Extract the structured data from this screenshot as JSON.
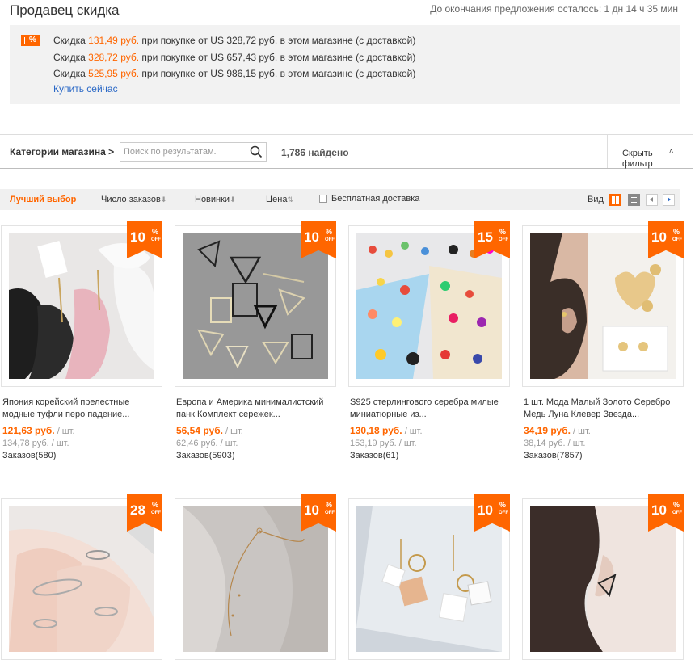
{
  "promo": {
    "title": "Продавец скидка",
    "timer": "До окончания предложения осталось: 1 дн 14 ч 35 мин",
    "badge": "%",
    "lines": [
      {
        "pre": "Скидка ",
        "amount": "131,49 руб.",
        "post": " при покупке от US 328,72 руб. в этом магазине (с доставкой)"
      },
      {
        "pre": "Скидка ",
        "amount": "328,72 руб.",
        "post": " при покупке от US 657,43 руб. в этом магазине (с доставкой)"
      },
      {
        "pre": "Скидка ",
        "amount": "525,95 руб.",
        "post": " при покупке от US 986,15 руб. в этом магазине (с доставкой)"
      }
    ],
    "buy_now": "Купить сейчас"
  },
  "catbar": {
    "label": "Категории магазина >",
    "search_placeholder": "Поиск по результатам.",
    "found": "1,786 найдено",
    "hide_filter": "Скрыть фильтр",
    "hide_arrow": "˄"
  },
  "sortbar": {
    "best": "Лучший выбор",
    "orders": "Число заказов",
    "new": "Новинки",
    "price": "Цена",
    "free_shipping": "Бесплатная доставка",
    "view": "Вид",
    "arrow_down": "⬇",
    "arrow_updown": "⇅"
  },
  "products": [
    {
      "discount": "10",
      "title": "Япония корейский прелестные модные туфли перо падение...",
      "price": "121,63 руб.",
      "unit": " / шт.",
      "old_price": "134,78 руб. / шт.",
      "orders": "Заказов(580)"
    },
    {
      "discount": "10",
      "title": "Европа и Америка минималистский панк Комплект сережек...",
      "price": "56,54 руб.",
      "unit": " / шт.",
      "old_price": "62,46 руб. / шт.",
      "orders": "Заказов(5903)"
    },
    {
      "discount": "15",
      "title": "S925 стерлингового серебра милые миниатюрные из...",
      "price": "130,18 руб.",
      "unit": " / шт.",
      "old_price": "153,19 руб. / шт.",
      "orders": "Заказов(61)"
    },
    {
      "discount": "10",
      "title": "1 шт. Мода Малый Золото Серебро Медь Луна Клевер Звезда...",
      "price": "34,19 руб.",
      "unit": " / шт.",
      "old_price": "38,14 руб. / шт.",
      "orders": "Заказов(7857)"
    },
    {
      "discount": "28"
    },
    {
      "discount": "10"
    },
    {
      "discount": "10"
    },
    {
      "discount": "10"
    }
  ],
  "badge_text": {
    "percent": "%",
    "off": "OFF"
  },
  "colors": {
    "accent": "#ff6600",
    "link": "#2a68c6"
  }
}
